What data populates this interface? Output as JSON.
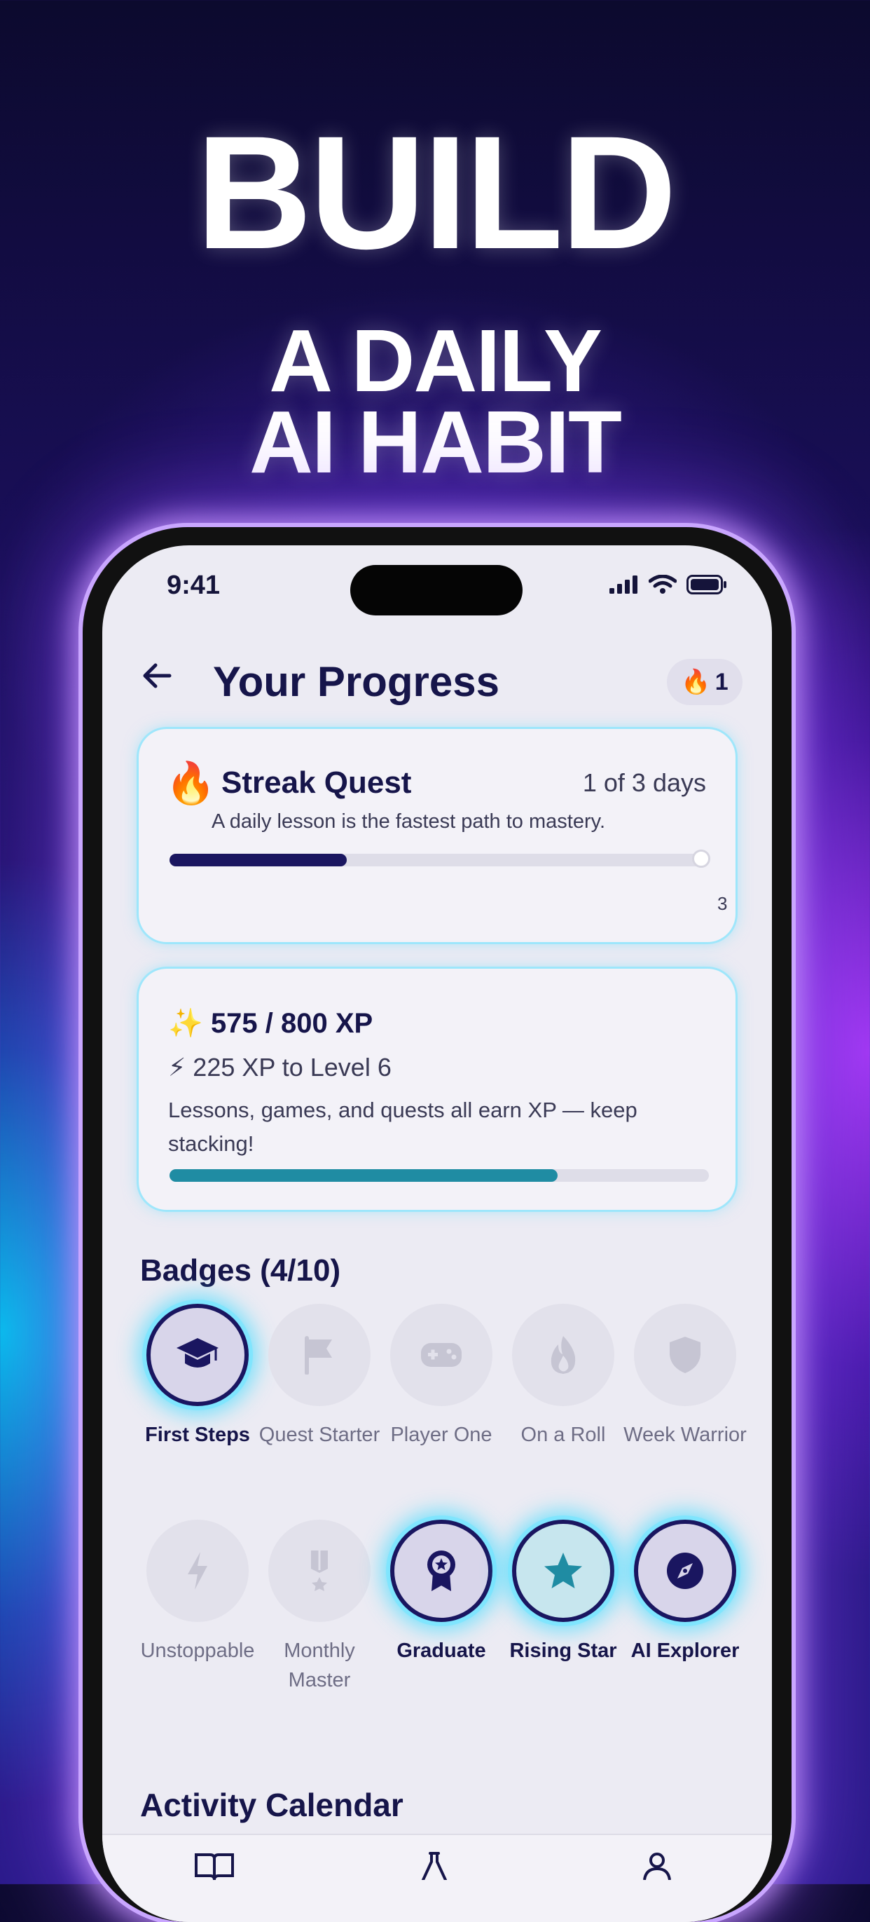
{
  "headline": {
    "line1": "BUILD",
    "line2": "A DAILY",
    "line3": "AI HABIT"
  },
  "status": {
    "time": "9:41"
  },
  "header": {
    "title": "Your Progress",
    "streak_count": "1"
  },
  "streak_quest": {
    "title": "Streak Quest",
    "days": "1 of 3 days",
    "subtitle": "A daily lesson is the fastest path to mastery.",
    "goal_label": "3",
    "progress": 0.33
  },
  "xp": {
    "title": "575 / 800 XP",
    "level_text": "225 XP to Level 6",
    "description": "Lessons, games, and quests all earn XP — keep stacking!",
    "progress": 0.72
  },
  "badges": {
    "heading": "Badges (4/10)",
    "items": [
      {
        "label": "First Steps",
        "icon": "graduation-cap-icon",
        "earned": true
      },
      {
        "label": "Quest Starter",
        "icon": "flag-icon",
        "earned": false
      },
      {
        "label": "Player One",
        "icon": "gamepad-icon",
        "earned": false
      },
      {
        "label": "On a Roll",
        "icon": "flame-icon",
        "earned": false
      },
      {
        "label": "Week Warrior",
        "icon": "shield-icon",
        "earned": false
      },
      {
        "label": "Unstoppable",
        "icon": "bolt-icon",
        "earned": false
      },
      {
        "label": "Monthly Master",
        "icon": "medal-icon",
        "earned": false
      },
      {
        "label": "Graduate",
        "icon": "award-icon",
        "earned": true
      },
      {
        "label": "Rising Star",
        "icon": "star-icon",
        "earned": true
      },
      {
        "label": "AI Explorer",
        "icon": "compass-icon",
        "earned": true
      }
    ]
  },
  "calendar": {
    "heading": "Activity Calendar"
  },
  "tabs": [
    {
      "icon": "book-icon"
    },
    {
      "icon": "flask-icon"
    },
    {
      "icon": "profile-icon"
    }
  ],
  "colors": {
    "navy": "#1a1660",
    "teal": "#1f8ca3",
    "glow": "#60dcff"
  }
}
